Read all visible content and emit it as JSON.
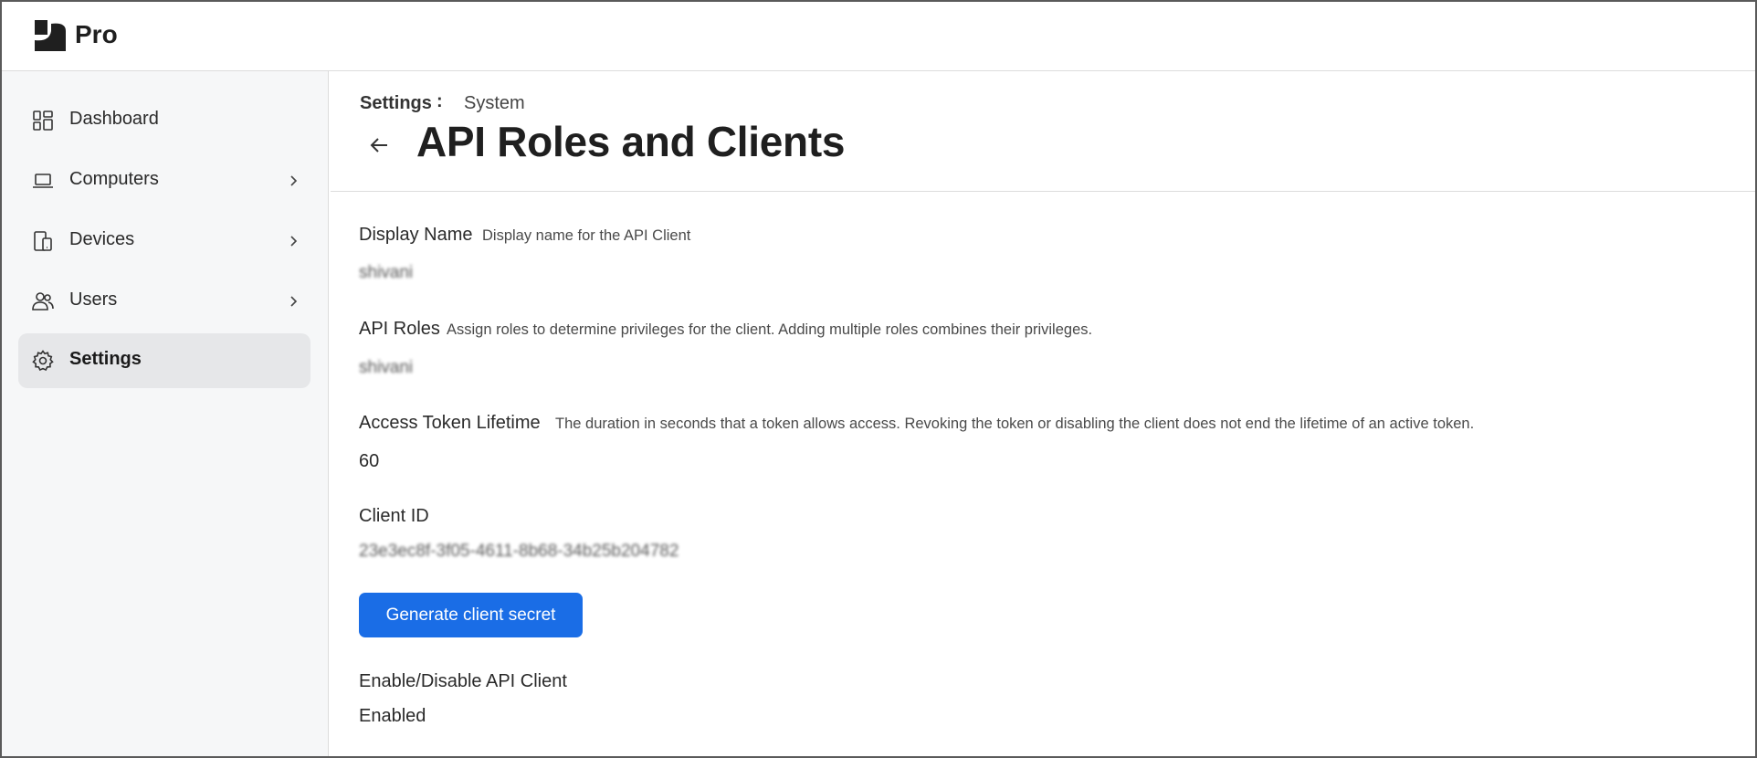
{
  "app": {
    "brand": "Pro"
  },
  "sidebar": {
    "items": [
      {
        "label": "Dashboard",
        "icon": "dashboard-icon",
        "has_chevron": false,
        "active": false
      },
      {
        "label": "Computers",
        "icon": "laptop-icon",
        "has_chevron": true,
        "active": false
      },
      {
        "label": "Devices",
        "icon": "devices-icon",
        "has_chevron": true,
        "active": false
      },
      {
        "label": "Users",
        "icon": "users-icon",
        "has_chevron": true,
        "active": false
      },
      {
        "label": "Settings",
        "icon": "gear-icon",
        "has_chevron": false,
        "active": true
      }
    ]
  },
  "breadcrumb": {
    "parent": "Settings",
    "separator": ":",
    "current": "System"
  },
  "page": {
    "title": "API Roles and Clients"
  },
  "fields": {
    "display_name": {
      "label": "Display Name",
      "description": "Display name for the API Client",
      "value": "shivani"
    },
    "api_roles": {
      "label": "API Roles",
      "description": "Assign roles to determine privileges for the client. Adding multiple roles combines their privileges.",
      "value": "shivani"
    },
    "token_lifetime": {
      "label": "Access Token Lifetime",
      "description": "The duration in seconds that a token allows access. Revoking the token or disabling the client does not end the lifetime of an active token.",
      "value": "60"
    },
    "client_id": {
      "label": "Client ID",
      "value": "23e3ec8f-3f05-4611-8b68-34b25b204782"
    },
    "enable_disable": {
      "label": "Enable/Disable API Client",
      "value": "Enabled"
    }
  },
  "actions": {
    "generate_secret": "Generate client secret"
  },
  "colors": {
    "accent": "#1a6de6",
    "sidebar_bg": "#f6f7f8",
    "active_item_bg": "#e6e7e9"
  }
}
